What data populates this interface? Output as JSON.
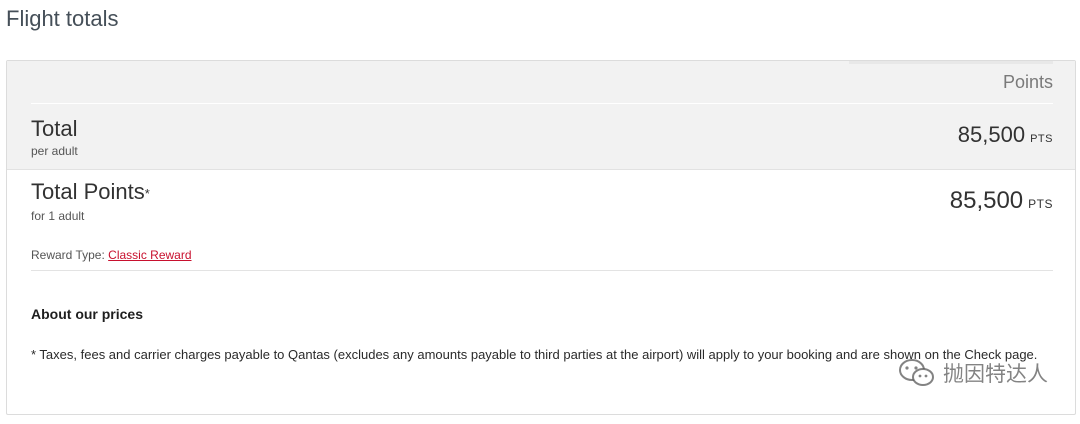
{
  "page": {
    "title": "Flight totals"
  },
  "table": {
    "column_header": "Points"
  },
  "total": {
    "title": "Total",
    "subtitle": "per adult",
    "amount": "85,500",
    "unit": "PTS"
  },
  "total_points": {
    "title": "Total Points",
    "star": "*",
    "subtitle": "for 1 adult",
    "amount": "85,500",
    "unit": "PTS"
  },
  "reward": {
    "label": "Reward Type: ",
    "link_text": "Classic Reward",
    "link_color": "#c8102e"
  },
  "about": {
    "heading": "About our prices",
    "text": "* Taxes, fees and carrier charges payable to Qantas (excludes any amounts payable to third parties at the airport) will apply to your booking and are shown on the Check page."
  },
  "watermark": {
    "text": "抛因特达人",
    "icon": "wechat-icon"
  }
}
